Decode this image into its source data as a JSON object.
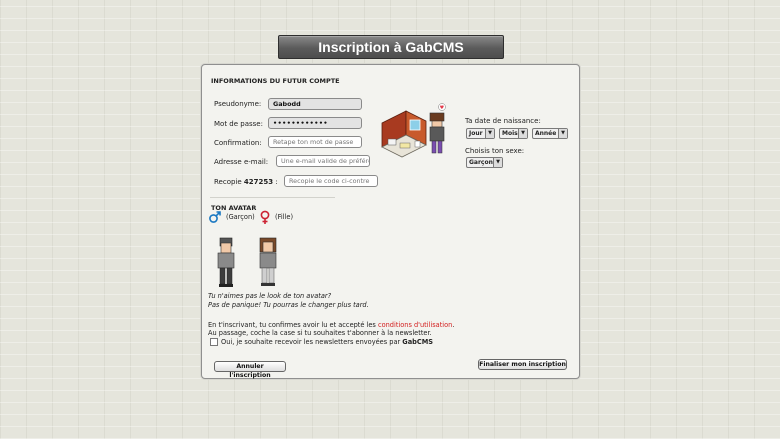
{
  "header": {
    "title": "Inscription à GabCMS"
  },
  "form": {
    "section_title": "INFORMATIONS DU FUTUR COMPTE",
    "pseudo": {
      "label": "Pseudonyme:",
      "value": "Gabodd"
    },
    "password": {
      "label": "Mot de passe:",
      "value": "••••••••••••"
    },
    "confirm": {
      "label": "Confirmation:",
      "placeholder": "Retape ton mot de passe"
    },
    "email": {
      "label": "Adresse e-mail:",
      "placeholder": "Une e-mail valide de préférence"
    },
    "captcha": {
      "label": "Recopie",
      "code": "427253",
      "suffix": ":",
      "placeholder": "Recopie le code ci-contre"
    },
    "birth": {
      "label": "Ta date de naissance:",
      "day": "Jour",
      "month": "Mois",
      "year": "Année"
    },
    "sex": {
      "label": "Choisis ton sexe:",
      "value": "Garçon"
    }
  },
  "avatar": {
    "section_title": "TON AVATAR",
    "male_label": "(Garçon)",
    "female_label": "(Fille)",
    "hint_line1": "Tu n'aimes pas le look de ton avatar?",
    "hint_line2": "Pas de panique! Tu pourras le changer plus tard."
  },
  "terms": {
    "line1_prefix": "En t'inscrivant, tu confirmes avoir lu et accepté les ",
    "line1_link": "conditions d'utilisation",
    "line1_suffix": ".",
    "line2": "Au passage, coche la case si tu souhaites t'abonner à la newsletter.",
    "newsletter_prefix": "Oui, je souhaite recevoir les newsletters envoyées par ",
    "newsletter_brand": "GabCMS"
  },
  "buttons": {
    "cancel": "Annuler l'inscription",
    "submit": "Finaliser mon inscription"
  },
  "colors": {
    "male_symbol": "#1a78c2",
    "female_symbol": "#cc2233",
    "link": "#d32020"
  }
}
